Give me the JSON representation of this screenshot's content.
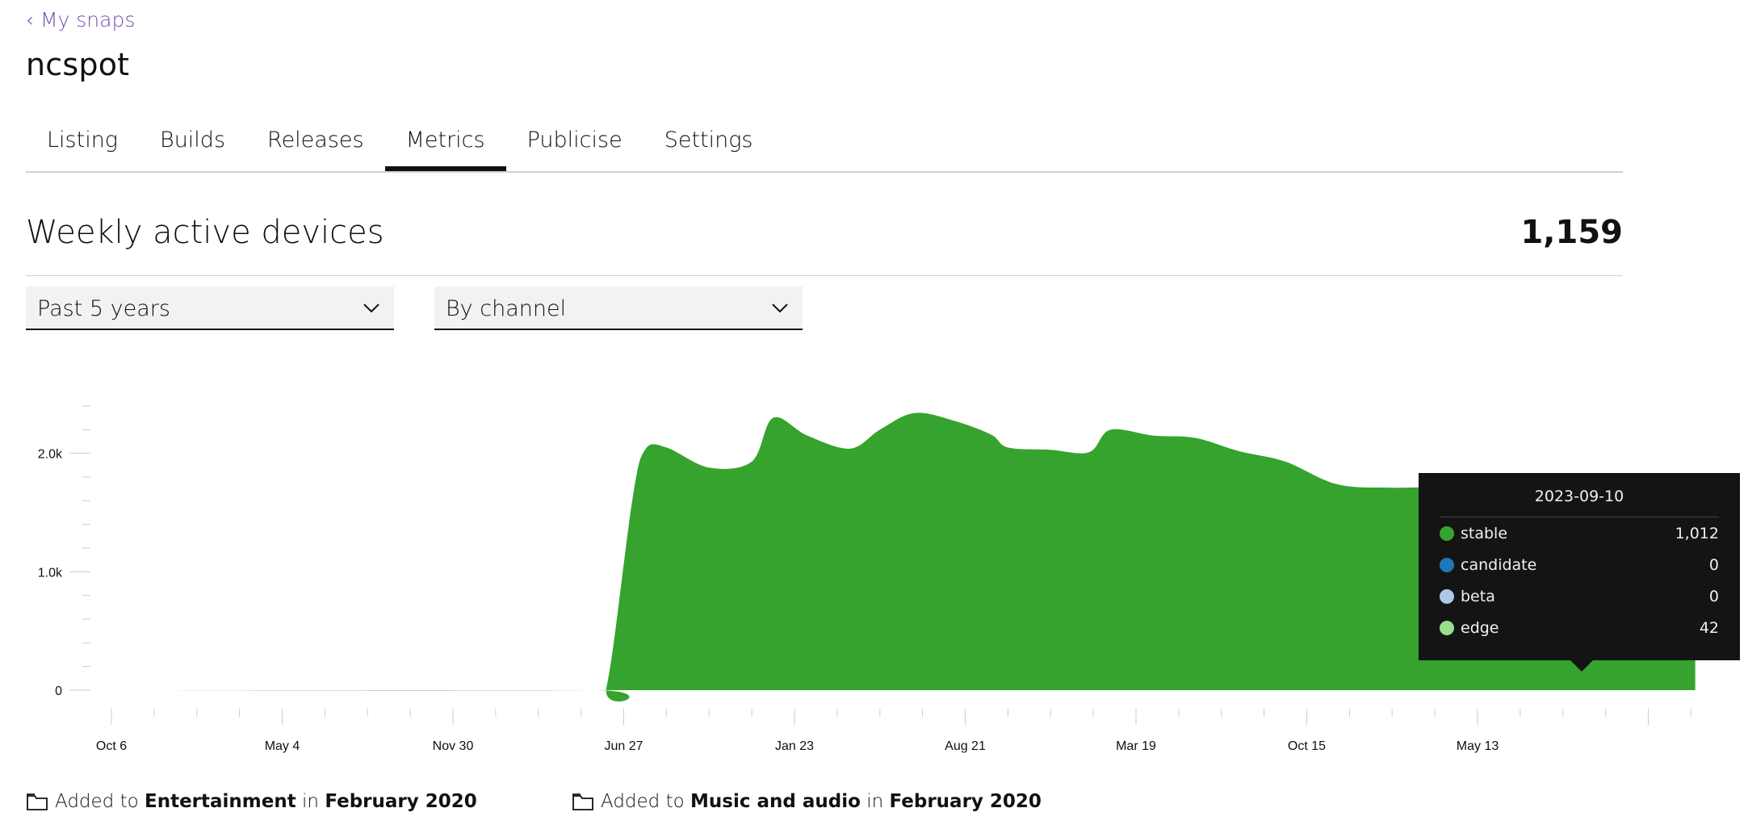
{
  "nav": {
    "back_link": "‹ My snaps"
  },
  "snap": {
    "name": "ncspot"
  },
  "tabs": [
    "Listing",
    "Builds",
    "Releases",
    "Metrics",
    "Publicise",
    "Settings"
  ],
  "active_tab": "Metrics",
  "metric": {
    "title": "Weekly active devices",
    "total": "1,159"
  },
  "filters": {
    "period": {
      "value": "Past 5 years"
    },
    "grouping": {
      "value": "By channel"
    }
  },
  "chart_data": {
    "type": "area",
    "x_ticks": [
      "Oct 6",
      "May 4",
      "Nov 30",
      "Jun 27",
      "Jan 23",
      "Aug 21",
      "Mar 19",
      "Oct 15",
      "May 13"
    ],
    "y_ticks": [
      "0",
      "1.0k",
      "2.0k"
    ],
    "ylim": [
      0,
      2400
    ],
    "grid": false,
    "series": [
      {
        "name": "stable",
        "color": "#36a32e",
        "points": [
          [
            0,
            0
          ],
          [
            11.2,
            0
          ],
          [
            11.6,
            30
          ],
          [
            12.2,
            1600
          ],
          [
            12.5,
            2030
          ],
          [
            13.0,
            2050
          ],
          [
            14.0,
            1880
          ],
          [
            15.0,
            1930
          ],
          [
            15.5,
            2300
          ],
          [
            16.3,
            2150
          ],
          [
            17.3,
            2040
          ],
          [
            18.0,
            2200
          ],
          [
            18.8,
            2340
          ],
          [
            19.7,
            2280
          ],
          [
            20.6,
            2160
          ],
          [
            21.0,
            2050
          ],
          [
            22.0,
            2030
          ],
          [
            22.9,
            2010
          ],
          [
            23.4,
            2200
          ],
          [
            24.4,
            2150
          ],
          [
            25.4,
            2130
          ],
          [
            26.4,
            2020
          ],
          [
            27.5,
            1930
          ],
          [
            28.7,
            1740
          ],
          [
            30.0,
            1710
          ],
          [
            32.0,
            1720
          ],
          [
            33.0,
            1640
          ],
          [
            34.0,
            1630
          ],
          [
            35.0,
            1700
          ],
          [
            35.9,
            1720
          ],
          [
            36.4,
            1680
          ],
          [
            37.1,
            1650
          ]
        ]
      },
      {
        "name": "candidate",
        "color": "#1f77b4",
        "points": []
      },
      {
        "name": "beta",
        "color": "#aec7e8",
        "points": []
      },
      {
        "name": "edge",
        "color": "#98df8a",
        "points": []
      }
    ]
  },
  "tooltip": {
    "date": "2023-09-10",
    "rows": [
      {
        "name": "stable",
        "value": "1,012",
        "color": "#36a32e"
      },
      {
        "name": "candidate",
        "value": "0",
        "color": "#1f77b4"
      },
      {
        "name": "beta",
        "value": "0",
        "color": "#aec7e8"
      },
      {
        "name": "edge",
        "value": "42",
        "color": "#98df8a"
      }
    ]
  },
  "annotations": [
    {
      "prefix": "Added to",
      "category": "Entertainment",
      "in_word": "in",
      "date": "February 2020"
    },
    {
      "prefix": "Added to",
      "category": "Music and audio",
      "in_word": "in",
      "date": "February 2020"
    }
  ]
}
